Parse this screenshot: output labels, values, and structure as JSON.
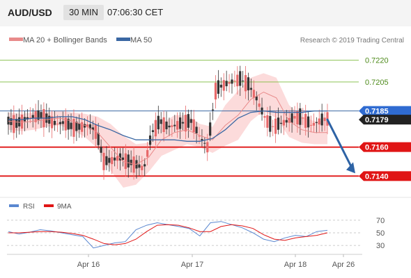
{
  "header": {
    "pair": "AUD/USD",
    "timeframe": "30 MIN",
    "time": "07:06:30 CET"
  },
  "legend": {
    "ma20": "MA 20 + Bollinger Bands",
    "ma50": "MA 50",
    "credit": "Research © 2019 Trading Central"
  },
  "colors": {
    "up_candle": "#e8696a",
    "down_candle": "#333333",
    "ma20": "#e88a8a",
    "bollinger_fill": "#fcd5d5",
    "ma50": "#3a67a3",
    "resistance_green": "#7bbb3b",
    "pivot_red": "#e01515",
    "blue_line": "#3a67a3",
    "arrow": "#2e63a5",
    "rsi": "#5a87d0",
    "rsi_ma": "#e01515"
  },
  "chart_data": {
    "type": "line",
    "title": "AUD/USD 30 MIN",
    "price_axis_labels": [
      "0.7220",
      "0.7205",
      "0.7185",
      "0.7179",
      "0.7160",
      "0.7140"
    ],
    "levels": [
      {
        "value": 0.722,
        "label": "0.7220",
        "kind": "resistance"
      },
      {
        "value": 0.7205,
        "label": "0.7205",
        "kind": "resistance"
      },
      {
        "value": 0.7185,
        "label": "0.7185",
        "kind": "current-blue"
      },
      {
        "value": 0.7179,
        "label": "0.7179",
        "kind": "last-price"
      },
      {
        "value": 0.716,
        "label": "0.7160",
        "kind": "pivot"
      },
      {
        "value": 0.714,
        "label": "0.7140",
        "kind": "support"
      }
    ],
    "x_labels": [
      "Apr 16",
      "Apr 17",
      "Apr 18",
      "Apr 26"
    ],
    "ylim": [
      0.7132,
      0.7228
    ],
    "series": [
      {
        "name": "MA 20 + Bollinger Bands",
        "values": [
          0.7178,
          0.7177,
          0.7178,
          0.7179,
          0.718,
          0.7178,
          0.7175,
          0.717,
          0.716,
          0.715,
          0.7148,
          0.7153,
          0.7165,
          0.717,
          0.7172,
          0.7168,
          0.7165,
          0.7175,
          0.7182,
          0.7193,
          0.7198,
          0.7194,
          0.7178,
          0.7172,
          0.717,
          0.717
        ]
      },
      {
        "name": "MA 50",
        "values": [
          0.7179,
          0.7179,
          0.718,
          0.718,
          0.7181,
          0.7181,
          0.7179,
          0.7175,
          0.7172,
          0.7168,
          0.7165,
          0.7165,
          0.7165,
          0.7165,
          0.7164,
          0.7164,
          0.7166,
          0.7172,
          0.718,
          0.7184,
          0.7185,
          0.7184,
          0.7184,
          0.7184,
          0.7185,
          0.7185
        ]
      }
    ],
    "forecast": {
      "from": 0.7179,
      "to": 0.714,
      "direction": "down"
    },
    "rsi": {
      "legend": [
        "RSI",
        "9MA"
      ],
      "tick_labels": [
        "70",
        "50",
        "30"
      ],
      "ylim": [
        18,
        82
      ],
      "rsi_values": [
        52,
        48,
        51,
        55,
        53,
        50,
        47,
        44,
        26,
        30,
        34,
        36,
        55,
        62,
        66,
        63,
        60,
        57,
        45,
        66,
        68,
        63,
        58,
        50,
        40,
        36,
        42,
        46,
        44,
        52,
        54
      ],
      "ma_values": [
        50,
        50,
        51,
        52,
        52,
        51,
        49,
        46,
        40,
        33,
        31,
        33,
        40,
        52,
        62,
        63,
        62,
        58,
        52,
        52,
        60,
        63,
        61,
        57,
        47,
        40,
        38,
        42,
        44,
        46,
        50
      ]
    }
  }
}
